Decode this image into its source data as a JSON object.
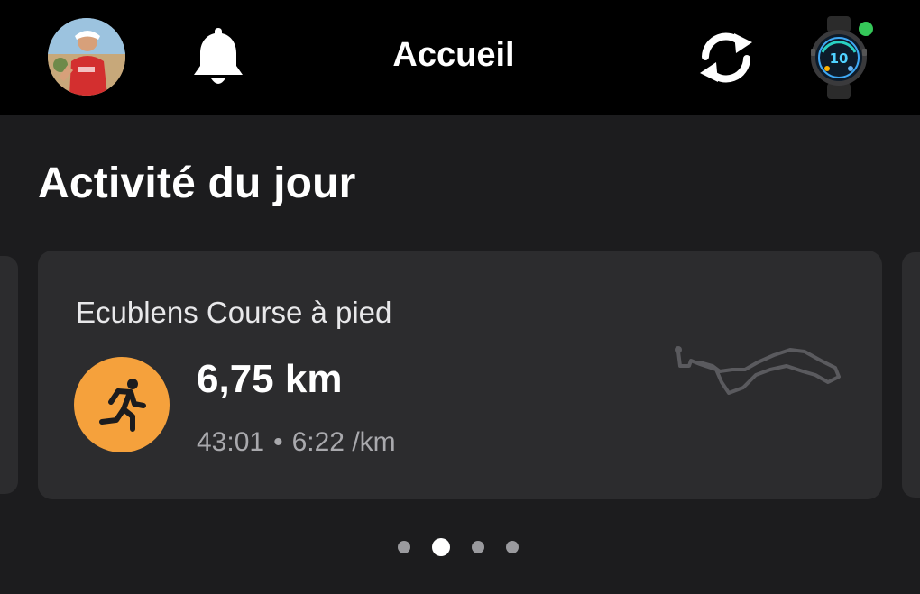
{
  "header": {
    "title": "Accueil",
    "icons": {
      "avatar": "user-avatar",
      "notifications": "bell-icon",
      "sync": "sync-icon",
      "device": "watch-icon",
      "device_status_color": "#35c759"
    }
  },
  "section": {
    "title": "Activité du jour"
  },
  "activity_card": {
    "title": "Ecublens Course à pied",
    "distance": "6,75 km",
    "duration": "43:01",
    "separator": "•",
    "pace": "6:22 /km",
    "icon": "running-icon",
    "icon_color": "#f5a13c"
  },
  "pagination": {
    "total": 4,
    "active_index": 1
  }
}
